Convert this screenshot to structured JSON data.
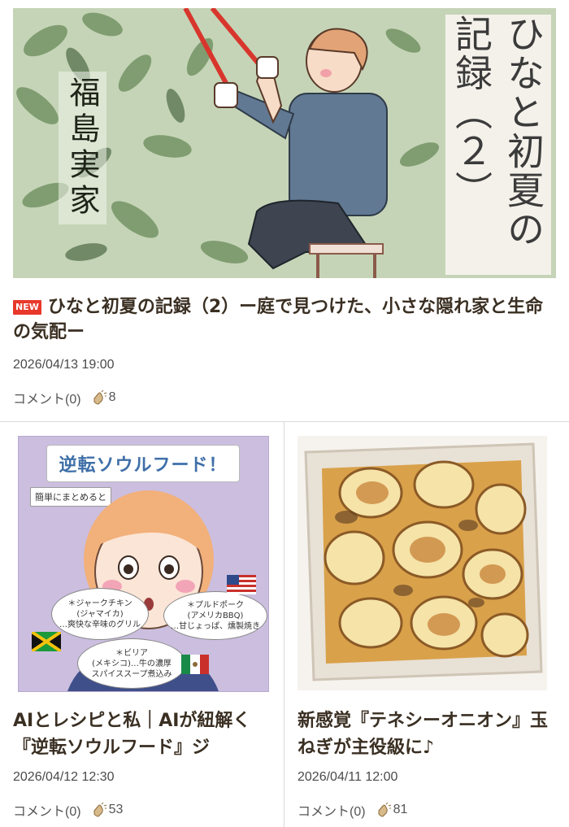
{
  "featured": {
    "image": {
      "vertical_title": [
        "ひなと初夏の",
        "記録（２）"
      ],
      "location": "福島実家"
    },
    "badge": "NEW",
    "title": "ひなと初夏の記録（2）ー庭で見つけた、小さな隠れ家と生命の気配ー",
    "date": "2026/04/13 19:00",
    "comments": "コメント(0)",
    "claps": "8"
  },
  "cards": [
    {
      "image": {
        "banner": "逆転ソウルフード！",
        "subtag": "簡単にまとめると",
        "bubbles": [
          [
            "＊ジャークチキン",
            "(ジャマイカ)",
            "…爽快な辛味のグリル"
          ],
          [
            "＊プルドポーク",
            "(アメリカBBQ)",
            "…甘じょっぱ、燻製焼き"
          ],
          [
            "＊ビリア",
            "(メキシコ)…牛の濃厚",
            "スパイススープ煮込み"
          ]
        ]
      },
      "title": "AIとレシピと私｜AIが紐解く『逆転ソウルフード』ジ",
      "date": "2026/04/12 12:30",
      "comments": "コメント(0)",
      "claps": "53"
    },
    {
      "title": "新感覚『テネシーオニオン』玉ねぎが主役級に♪",
      "date": "2026/04/11 12:00",
      "comments": "コメント(0)",
      "claps": "81"
    }
  ],
  "colors": {
    "new_badge": "#e8382a",
    "title_text": "#3a2f22",
    "divider": "#d9d9d9"
  }
}
